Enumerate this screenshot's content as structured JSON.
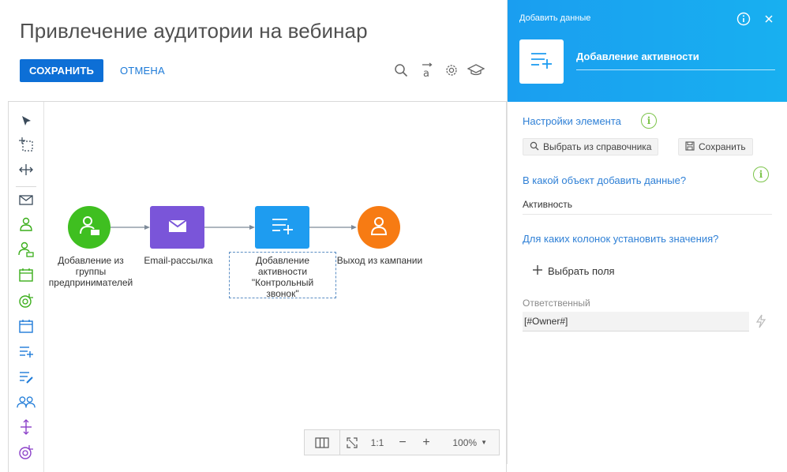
{
  "header": {
    "title": "Привлечение аудитории на вебинар",
    "save_label": "СОХРАНИТЬ",
    "cancel_label": "ОТМЕНА"
  },
  "toolbar_icons": [
    "search-icon",
    "text-format-icon",
    "gear-icon",
    "graduation-cap-icon"
  ],
  "palette": {
    "items": [
      "pointer-icon",
      "lasso-select-icon",
      "space-tool-icon",
      "email-icon",
      "add-from-group-icon",
      "add-from-folder-icon",
      "event-participant-icon",
      "signal-icon",
      "calendar-icon",
      "add-data-icon",
      "modify-data-icon",
      "audience-icon",
      "split-icon",
      "condition-signal-icon"
    ]
  },
  "diagram": {
    "nodes": [
      {
        "id": "add-from-group",
        "label": "Добавление из группы предпринимателей",
        "color": "#3fbf20",
        "icon": "user-folder-icon"
      },
      {
        "id": "email",
        "label": "Email-рассылка",
        "color": "#7a55d9",
        "icon": "envelope-icon"
      },
      {
        "id": "add-activity",
        "label": "Добавление активности \"Контрольный звонок\"",
        "color": "#1e9cf0",
        "icon": "add-list-icon"
      },
      {
        "id": "exit",
        "label": "Выход из кампании",
        "color": "#f77b13",
        "icon": "user-exit-icon"
      }
    ]
  },
  "zoombar": {
    "one_to_one": "1:1",
    "minus": "−",
    "plus": "+",
    "zoom_level": "100%"
  },
  "panel": {
    "header_label": "Добавить данные",
    "element_name": "Добавление активности",
    "settings_title": "Настройки элемента",
    "select_from_lookup": "Выбрать из справочника",
    "save_label": "Сохранить",
    "object_question": "В какой объект добавить данные?",
    "object_value": "Активность",
    "columns_question": "Для каких колонок установить значения?",
    "select_fields": "Выбрать поля",
    "owner_label": "Ответственный",
    "owner_value": "[#Owner#]"
  },
  "colors": {
    "accent": "#0d6fd6",
    "link": "#2f80d6",
    "panel_header": "#1aa6f0",
    "info_green": "#7cc44a"
  }
}
